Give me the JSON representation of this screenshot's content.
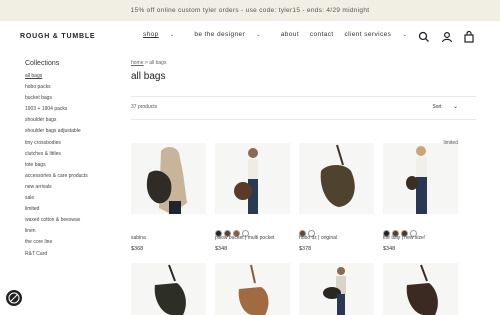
{
  "promo": "15% off online custom tyler orders - use code: tyler15 - ends: 4/29 midnight",
  "header": {
    "logo": "ROUGH & TUMBLE",
    "nav": [
      {
        "label": "shop",
        "chevron": true
      },
      {
        "label": "be the designer",
        "chevron": true
      },
      {
        "label": "about",
        "chevron": false
      },
      {
        "label": "contact",
        "chevron": false
      },
      {
        "label": "client services",
        "chevron": true
      }
    ],
    "icons": [
      "search-icon",
      "account-icon",
      "cart-icon"
    ]
  },
  "sidebar": {
    "title": "Collections",
    "items": [
      "all bags",
      "hobo packs",
      "bucket bags",
      "1903 + 1904 packs",
      "shoulder bags",
      "shoulder bags adjustable",
      "tiny crossbodies",
      "clutches & littles",
      "tote bags",
      "accessories & care products",
      "new arrivals",
      "sale",
      "limited",
      "waxed cotton & beeswax",
      "linen",
      "the core line",
      "R&T Card"
    ]
  },
  "main": {
    "breadcrumb": {
      "home": "home",
      "sep": ">",
      "current": "all bags"
    },
    "title": "all bags",
    "count": "37 products",
    "sort": "Sort"
  },
  "products": [
    {
      "name": "sabina",
      "price": "$368",
      "swatches": [],
      "limited": ""
    },
    {
      "name": "pillow bucket | multi pocket",
      "price": "$348",
      "swatches": [
        "#222222",
        "#5a3d2b",
        "#8a5a3c",
        "#ffffff"
      ],
      "limited": ""
    },
    {
      "name": "hobo dz | original",
      "price": "$378",
      "swatches": [
        "#5b4a32",
        "#ffffff"
      ],
      "limited": ""
    },
    {
      "name": "the tully | new size!",
      "price": "$348",
      "swatches": [
        "#222222",
        "#5a3d2b",
        "#4a3a2a",
        "#ffffff"
      ],
      "limited": "limited"
    }
  ],
  "accent": "#f1eee4"
}
